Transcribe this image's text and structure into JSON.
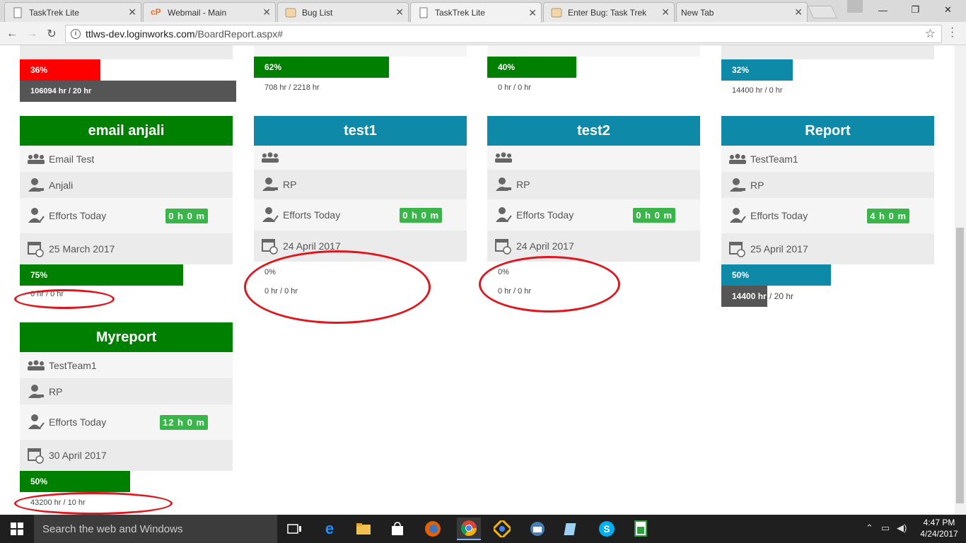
{
  "browser": {
    "tabs": [
      {
        "label": "TaskTrek Lite",
        "icon": "page-icon"
      },
      {
        "label": "Webmail - Main",
        "icon": "cpanel-icon"
      },
      {
        "label": "Bug List",
        "icon": "bug-icon"
      },
      {
        "label": "TaskTrek Lite",
        "icon": "page-icon",
        "active": true
      },
      {
        "label": "Enter Bug: Task Trek",
        "icon": "bug-icon"
      },
      {
        "label": "New Tab",
        "icon": "none"
      }
    ],
    "url_host": "ttlws-dev.loginworks.com",
    "url_path": "/BoardReport.aspx#"
  },
  "top_partial": [
    {
      "bar_percent": "36%",
      "bar_fill": 0.36,
      "bar_color": "#ff0000",
      "hours": "106094 hr / 20 hr",
      "hours_style": "dark"
    },
    {
      "bar_percent": "62%",
      "bar_fill": 0.62,
      "bar_color": "#008000",
      "hours": "708 hr / 2218 hr"
    },
    {
      "bar_percent": "40%",
      "bar_fill": 0.4,
      "bar_color": "#008000",
      "hours": "0 hr / 0 hr"
    },
    {
      "bar_percent": "32%",
      "bar_fill": 0.32,
      "bar_color": "#0e8aa8",
      "hours": "14400 hr / 0 hr"
    }
  ],
  "cards": [
    {
      "title": "email anjali",
      "header_color": "#008000",
      "team": "Email Test",
      "user": "Anjali",
      "efforts_label": "Efforts Today",
      "efforts": "0 h 0 m",
      "date": "25 March 2017",
      "bar_percent": "75%",
      "bar_fill": 0.75,
      "bar_color": "#008000",
      "hours": "0 hr / 0 hr"
    },
    {
      "title": "test1",
      "header_color": "#0e8aa8",
      "team": "",
      "user": "RP",
      "efforts_label": "Efforts Today",
      "efforts": "0 h 0 m",
      "date": "24 April 2017",
      "bar_percent": "0%",
      "bar_fill": 0,
      "bar_color": "#0e8aa8",
      "hours": "0 hr / 0 hr"
    },
    {
      "title": "test2",
      "header_color": "#0e8aa8",
      "team": "",
      "user": "RP",
      "efforts_label": "Efforts Today",
      "efforts": "0 h 0 m",
      "date": "24 April 2017",
      "bar_percent": "0%",
      "bar_fill": 0,
      "bar_color": "#0e8aa8",
      "hours": "0 hr / 0 hr"
    },
    {
      "title": "Report",
      "header_color": "#0e8aa8",
      "team": "TestTeam1",
      "user": "RP",
      "efforts_label": "Efforts Today",
      "efforts": "4 h 0 m",
      "date": "25 April 2017",
      "bar_percent": "50%",
      "bar_fill": 0.5,
      "bar_color": "#0e8aa8",
      "hours_highlight": "14400 hr",
      "hours_rest": "/ 20 hr"
    },
    {
      "title": "Myreport",
      "header_color": "#008000",
      "team": "TestTeam1",
      "user": "RP",
      "efforts_label": "Efforts Today",
      "efforts": "12 h 0 m",
      "date": "30 April 2017",
      "bar_percent": "50%",
      "bar_fill": 0.5,
      "bar_color": "#008000",
      "hours": "43200 hr / 10 hr"
    }
  ],
  "taskbar": {
    "search_placeholder": "Search the web and Windows",
    "time": "4:47 PM",
    "date": "4/24/2017"
  }
}
